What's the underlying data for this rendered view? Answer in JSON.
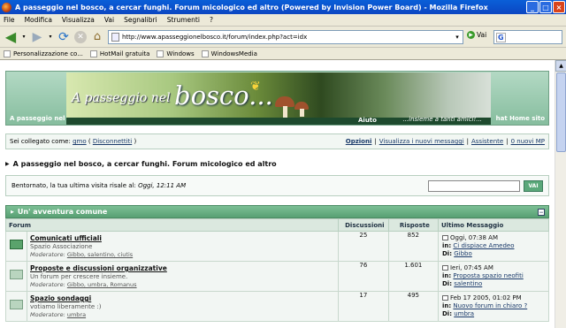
{
  "window": {
    "title": "A passeggio nel bosco, a cercar funghi. Forum micologico ed altro (Powered by Invision Power Board) - Mozilla Firefox"
  },
  "menu": [
    "File",
    "Modifica",
    "Visualizza",
    "Vai",
    "Segnalibri",
    "Strumenti",
    "?"
  ],
  "toolbar": {
    "url": "http://www.apasseggionelbosco.it/forum/index.php?act=idx",
    "go_label": "Vai",
    "search_engine": "G"
  },
  "bookmarks": [
    "Personalizzazione co...",
    "HotMail gratuita",
    "Windows",
    "WindowsMedia"
  ],
  "banner": {
    "title_part1": "A passeggio nel",
    "title_part2": "bosco...",
    "tagline": "...insieme a tanti amici!...",
    "nav_left": "A passeggio nel",
    "nav_aiuto": "Aiuto",
    "nav_right": "hat   Home sito"
  },
  "userbar": {
    "prefix": "Sei collegato come:",
    "username": "gmo",
    "logout": "Disconnettiti",
    "links": [
      "Opzioni",
      "Visualizza i nuovi messaggi",
      "Assistente",
      "0 nuovi MP"
    ]
  },
  "page_title": "A passeggio nel bosco, a cercar funghi. Forum micologico ed altro",
  "welcome": {
    "text": "Bentornato, la tua ultima visita risale al:",
    "last_visit": "Oggi, 12:11 AM",
    "button": "VAI"
  },
  "category": {
    "name": "Un' avventura comune"
  },
  "table": {
    "headers": [
      "Forum",
      "Discussioni",
      "Risposte",
      "Ultimo Messaggio"
    ],
    "rows": [
      {
        "title": "Comunicati ufficiali",
        "desc": "Spazio Associazione",
        "mod_label": "Moderatore:",
        "mods": "Gibbo, salentino, ciutis",
        "topics": "25",
        "replies": "852",
        "last_date": "Oggi, 07:38 AM",
        "last_in_label": "in:",
        "last_in": "Ci dispiace Amedeo",
        "last_by_label": "Di:",
        "last_by": "Gibbo",
        "new": true
      },
      {
        "title": "Proposte e discussioni organizzative",
        "desc": "Un forum per crescere insieme.",
        "mod_label": "Moderatore:",
        "mods": "Gibbo, umbra, Romanus",
        "topics": "76",
        "replies": "1.601",
        "last_date": "Ieri, 07:45 AM",
        "last_in_label": "in:",
        "last_in": "Proposta spazio neofiti",
        "last_by_label": "Di:",
        "last_by": "salentino",
        "new": false
      },
      {
        "title": "Spazio sondaggi",
        "desc": "votiamo liberamente :)",
        "mod_label": "Moderatore:",
        "mods": "umbra",
        "topics": "17",
        "replies": "495",
        "last_date": "Feb 17 2005, 01:02 PM",
        "last_in_label": "in:",
        "last_in": "Nuovo forum in chiaro ?",
        "last_by_label": "Di:",
        "last_by": "umbra",
        "new": false
      }
    ]
  }
}
